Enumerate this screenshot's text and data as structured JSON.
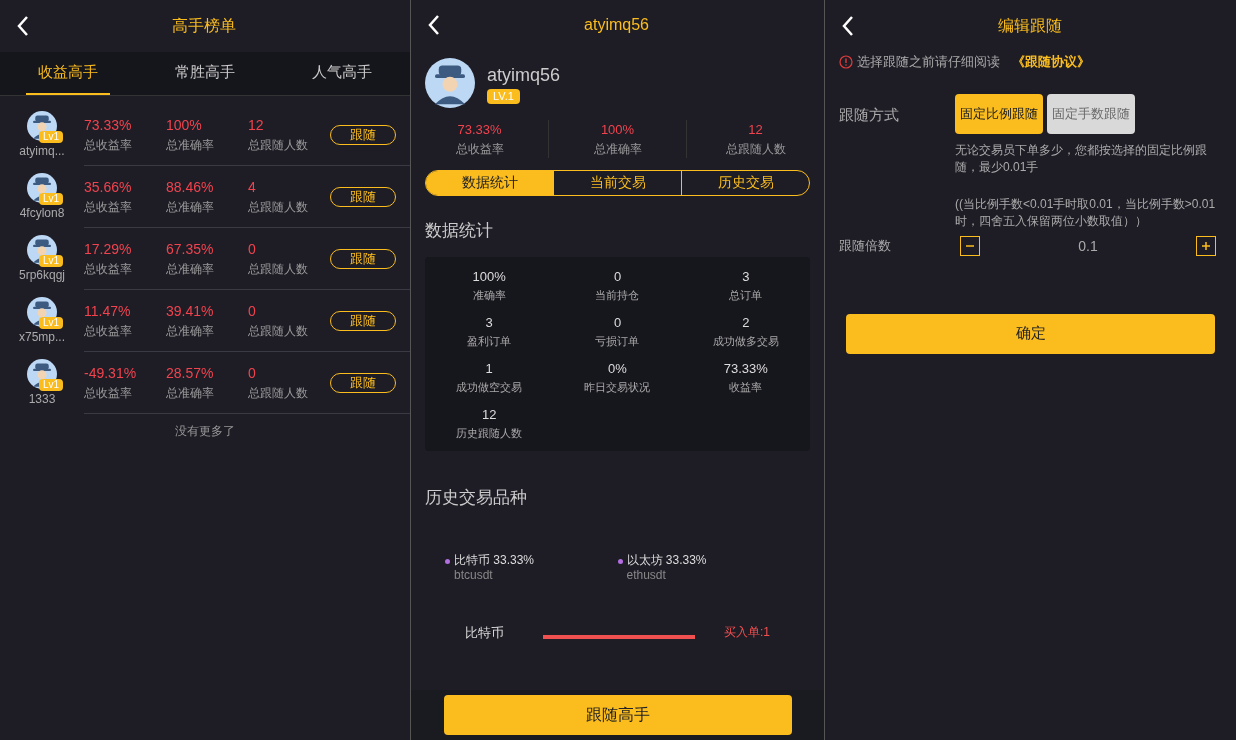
{
  "leaderboard": {
    "title": "高手榜单",
    "tabs": [
      {
        "label": "收益高手",
        "selected": true
      },
      {
        "label": "常胜高手",
        "selected": false
      },
      {
        "label": "人气高手",
        "selected": false
      }
    ],
    "rows": [
      {
        "name": "atyimq...",
        "level": "Lv1",
        "profit": "73.33%",
        "profit_label": "总收益率",
        "accuracy": "100%",
        "accuracy_label": "总准确率",
        "followers": "12",
        "followers_label": "总跟随人数",
        "button": "跟随"
      },
      {
        "name": "4fcylon8",
        "level": "Lv1",
        "profit": "35.66%",
        "profit_label": "总收益率",
        "accuracy": "88.46%",
        "accuracy_label": "总准确率",
        "followers": "4",
        "followers_label": "总跟随人数",
        "button": "跟随"
      },
      {
        "name": "5rp6kqgj",
        "level": "Lv1",
        "profit": "17.29%",
        "profit_label": "总收益率",
        "accuracy": "67.35%",
        "accuracy_label": "总准确率",
        "followers": "0",
        "followers_label": "总跟随人数",
        "button": "跟随"
      },
      {
        "name": "x75mp...",
        "level": "Lv1",
        "profit": "11.47%",
        "profit_label": "总收益率",
        "accuracy": "39.41%",
        "accuracy_label": "总准确率",
        "followers": "0",
        "followers_label": "总跟随人数",
        "button": "跟随"
      },
      {
        "name": "1333",
        "level": "Lv1",
        "profit": "-49.31%",
        "profit_label": "总收益率",
        "accuracy": "28.57%",
        "accuracy_label": "总准确率",
        "followers": "0",
        "followers_label": "总跟随人数",
        "button": "跟随"
      }
    ],
    "end_note": "没有更多了"
  },
  "profile": {
    "title": "atyimq56",
    "name": "atyimq56",
    "level": "LV.1",
    "stats": [
      {
        "value": "73.33%",
        "label": "总收益率"
      },
      {
        "value": "100%",
        "label": "总准确率"
      },
      {
        "value": "12",
        "label": "总跟随人数"
      }
    ],
    "tabs": [
      {
        "label": "数据统计",
        "selected": true
      },
      {
        "label": "当前交易",
        "selected": false
      },
      {
        "label": "历史交易",
        "selected": false
      }
    ],
    "section_title": "数据统计",
    "grid": [
      {
        "value": "100%",
        "label": "准确率"
      },
      {
        "value": "0",
        "label": "当前持仓"
      },
      {
        "value": "3",
        "label": "总订单"
      },
      {
        "value": "3",
        "label": "盈利订单"
      },
      {
        "value": "0",
        "label": "亏损订单"
      },
      {
        "value": "2",
        "label": "成功做多交易"
      },
      {
        "value": "1",
        "label": "成功做空交易"
      },
      {
        "value": "0%",
        "label": "昨日交易状况"
      },
      {
        "value": "73.33%",
        "label": "收益率"
      },
      {
        "value": "12",
        "label": "历史跟随人数"
      }
    ],
    "history_title": "历史交易品种",
    "legend": [
      {
        "name": "比特币 33.33%",
        "symbol": "btcusdt",
        "color": "#b36ee0"
      },
      {
        "name": "以太坊 33.33%",
        "symbol": "ethusdt",
        "color": "#b36ee0"
      }
    ],
    "trade_row": {
      "name": "比特币",
      "buy": "买入单:1"
    },
    "follow_button": "跟随高手"
  },
  "edit": {
    "title": "编辑跟随",
    "warning": "选择跟随之前请仔细阅读",
    "agreement": "《跟随协议》",
    "method_label": "跟随方式",
    "methods": [
      {
        "label": "固定比例跟随",
        "selected": true
      },
      {
        "label": "固定手数跟随",
        "selected": false
      }
    ],
    "description": "无论交易员下单多少，您都按选择的固定比例跟随，最少0.01手",
    "note": "((当比例手数<0.01手时取0.01，当比例手数>0.01时，四舍五入保留两位小数取值））",
    "multiplier_label": "跟随倍数",
    "multiplier": "0.1",
    "confirm": "确定"
  }
}
